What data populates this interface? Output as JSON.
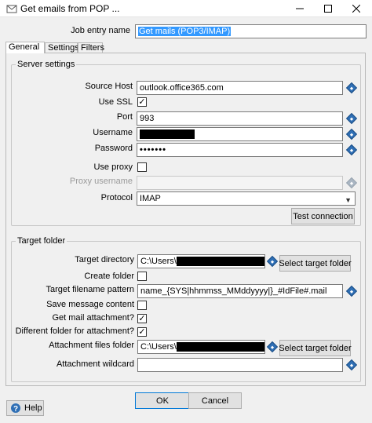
{
  "window": {
    "title": "Get emails from POP ...",
    "minimize_icon": "minimize-icon",
    "maximize_icon": "maximize-icon",
    "close_icon": "close-icon"
  },
  "job_entry": {
    "label": "Job entry name",
    "value": "Get mails (POP3/IMAP)"
  },
  "tabs": [
    {
      "label": "General"
    },
    {
      "label": "Settings"
    },
    {
      "label": "Filters"
    }
  ],
  "server": {
    "group_title": "Server settings",
    "source_host_label": "Source Host",
    "source_host_value": "outlook.office365.com",
    "use_ssl_label": "Use SSL",
    "use_ssl_checked": true,
    "port_label": "Port",
    "port_value": "993",
    "username_label": "Username",
    "password_label": "Password",
    "password_value": "•••••••",
    "use_proxy_label": "Use proxy",
    "use_proxy_checked": false,
    "proxy_username_label": "Proxy username",
    "protocol_label": "Protocol",
    "protocol_value": "IMAP",
    "test_connection_label": "Test connection"
  },
  "target": {
    "group_title": "Target folder",
    "target_directory_label": "Target directory",
    "target_directory_value": "C:\\Users\\",
    "select_target_folder_label": "Select target folder",
    "create_folder_label": "Create folder",
    "create_folder_checked": false,
    "filename_pattern_label": "Target filename pattern",
    "filename_pattern_value": "name_{SYS|hhmmss_MMddyyyy|}_#IdFile#.mail",
    "save_message_label": "Save message content",
    "save_message_checked": false,
    "get_attachment_label": "Get mail attachment?",
    "get_attachment_checked": true,
    "different_folder_label": "Different folder for attachment?",
    "different_folder_checked": true,
    "attachment_folder_label": "Attachment files folder",
    "attachment_folder_value": "C:\\Users\\",
    "select_attachment_folder_label": "Select target folder",
    "attachment_wildcard_label": "Attachment wildcard"
  },
  "footer": {
    "ok_label": "OK",
    "cancel_label": "Cancel",
    "help_label": "Help"
  },
  "colors": {
    "selection": "#3399ff",
    "variable_icon": "#2f6fb5"
  }
}
